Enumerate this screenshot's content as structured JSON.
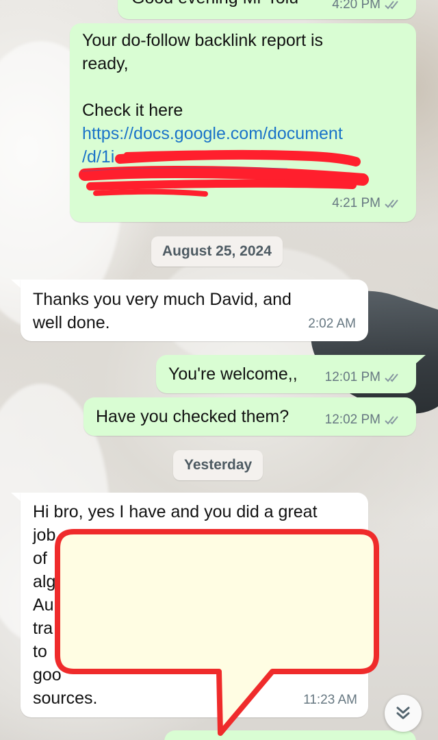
{
  "messages": [
    {
      "id": "m0",
      "direction": "outgoing",
      "text": "Good evening Mr Tolu",
      "time": "4:20 PM",
      "status": "read"
    },
    {
      "id": "m1",
      "direction": "outgoing",
      "line1": "Your do-follow backlink report is",
      "line2": "ready,",
      "line3": "Check it here",
      "link_line1": "https://docs.google.com/document",
      "link_line2": "/d/1i",
      "time": "4:21 PM",
      "status": "read"
    },
    {
      "id": "m2",
      "direction": "incoming",
      "line1": "Thanks you very much David, and",
      "line2": "well done.",
      "time": "2:02 AM"
    },
    {
      "id": "m3",
      "direction": "outgoing",
      "text": "You're welcome,,",
      "time": "12:01 PM",
      "status": "read"
    },
    {
      "id": "m4",
      "direction": "outgoing",
      "text": "Have you checked them?",
      "time": "12:02 PM",
      "status": "read"
    },
    {
      "id": "m5",
      "direction": "incoming",
      "line1": "Hi bro, yes I have and you did a great",
      "line2": "job",
      "line3": "of",
      "line4": "alg",
      "line5": "Au",
      "line6": "tra",
      "line7": "to",
      "line8": "goo",
      "line9": "sources.",
      "time": "11:23 AM"
    }
  ],
  "date_chips": {
    "aug": "August 25, 2024",
    "yesterday": "Yesterday"
  },
  "icons": {
    "read_receipt": "double-check-icon",
    "scroll_down": "double-chevron-down-icon"
  },
  "colors": {
    "outgoing_bubble": "#d9fdd3",
    "incoming_bubble": "#ffffff",
    "link": "#1a73c8",
    "redaction": "#ff1f2d",
    "callout_fill": "#fffde3",
    "callout_border": "#ef2b2b"
  }
}
